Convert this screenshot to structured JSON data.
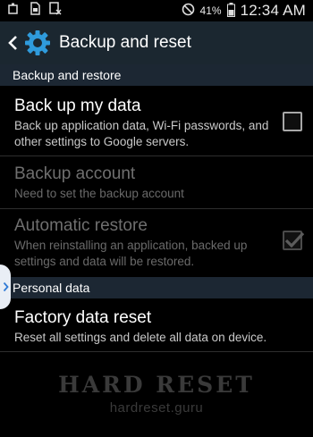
{
  "status_bar": {
    "battery": "41%",
    "time": "12:34 AM",
    "icons": [
      "usb-icon",
      "sim-icon",
      "download-icon",
      "no-signal-icon",
      "battery-icon"
    ]
  },
  "action_bar": {
    "title": "Backup and reset",
    "icon": "settings-gear-icon"
  },
  "sections": {
    "backup_restore": {
      "header": "Backup and restore",
      "back_up_my_data": {
        "title": "Back up my data",
        "summary": "Back up application data, Wi-Fi passwords, and other settings to Google servers.",
        "checked": false
      },
      "backup_account": {
        "title": "Backup account",
        "summary": "Need to set the backup account",
        "enabled": false
      },
      "automatic_restore": {
        "title": "Automatic restore",
        "summary": "When reinstalling an application, backed up settings and data will be restored.",
        "checked": true,
        "enabled": false
      }
    },
    "personal_data": {
      "header": "Personal data",
      "factory_reset": {
        "title": "Factory data reset",
        "summary": "Reset all settings and delete all data on device."
      }
    }
  },
  "watermark": {
    "title": "HARD RESET",
    "subtitle": "hardreset.guru"
  },
  "colors": {
    "action_bar": "#1b2730",
    "section_header": "#1c2733",
    "accent": "#2f9bdc"
  }
}
